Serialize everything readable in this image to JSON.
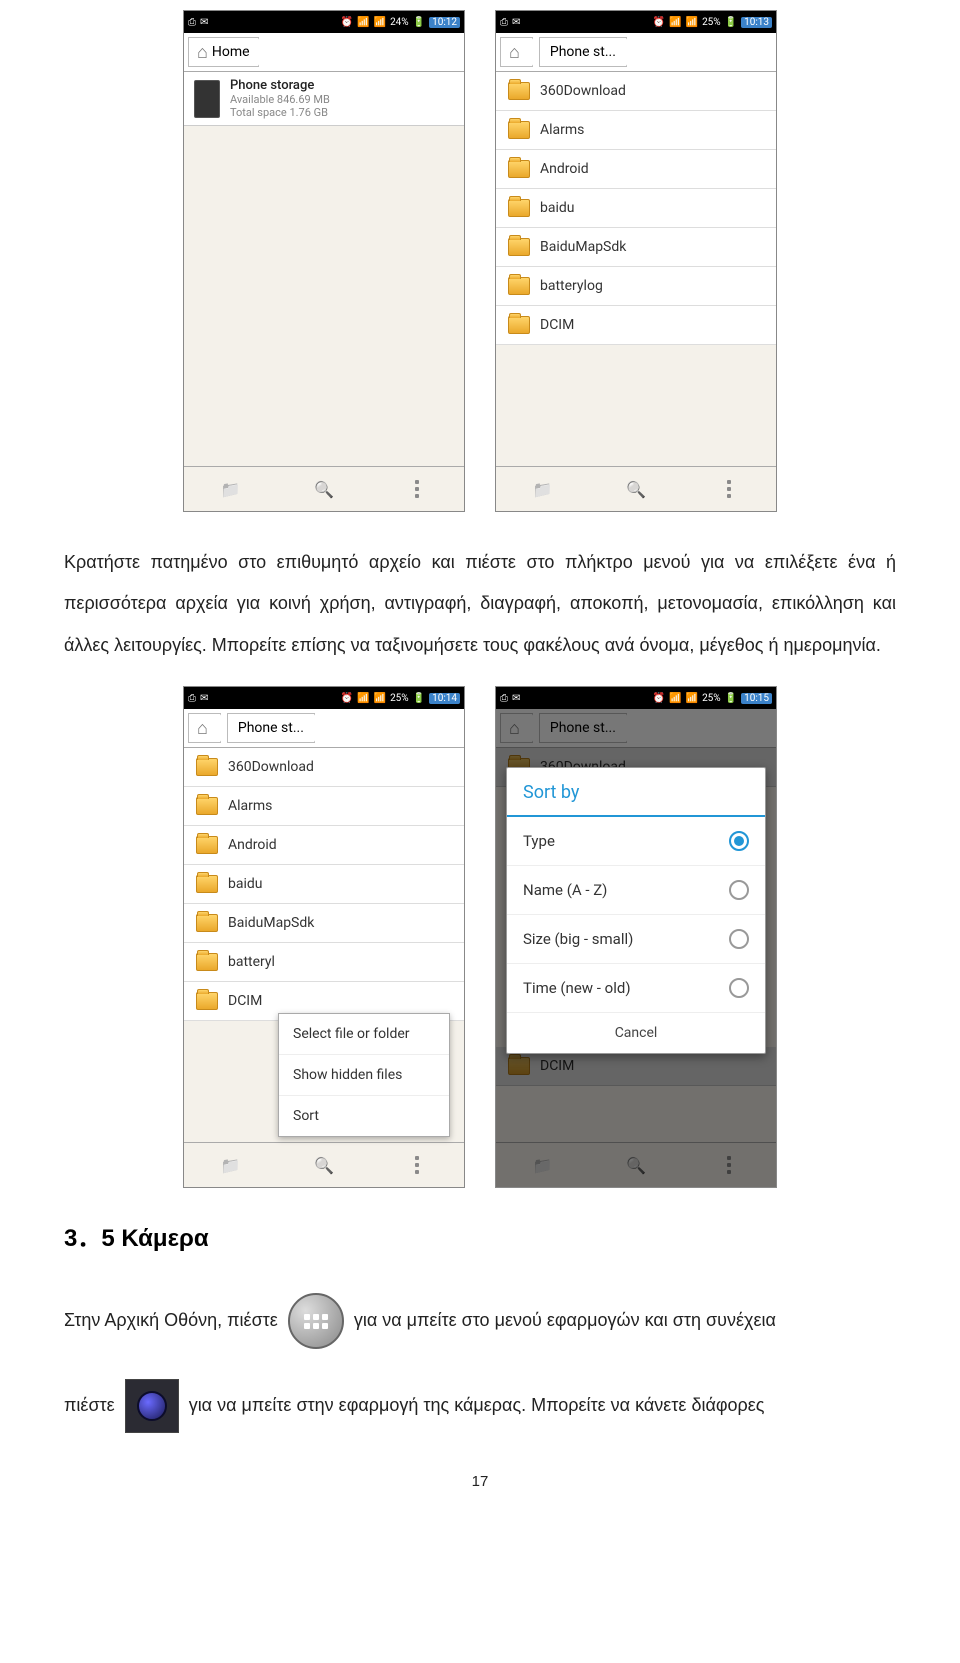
{
  "shot1": {
    "status": {
      "battery": "24%",
      "time": "10:12"
    },
    "breadcrumb": [
      "Home"
    ],
    "storage": {
      "title": "Phone storage",
      "avail": "Available 846.69 MB",
      "total": "Total space 1.76 GB"
    }
  },
  "shot2": {
    "status": {
      "battery": "25%",
      "time": "10:13"
    },
    "breadcrumb": [
      "",
      "Phone st..."
    ],
    "folders": [
      "360Download",
      "Alarms",
      "Android",
      "baidu",
      "BaiduMapSdk",
      "batterylog",
      "DCIM"
    ]
  },
  "para1": "Κρατήστε πατημένο στο επιθυμητό αρχείο και πιέστε στο πλήκτρο μενού για να επιλέξετε ένα ή περισσότερα αρχεία για κοινή χρήση, αντιγραφή, διαγραφή, αποκοπή, μετονομασία, επικόλληση και άλλες λειτουργίες. Μπορείτε επίσης να ταξινομήσετε τους φακέλους ανά όνομα, μέγεθος ή ημερομηνία.",
  "shot3": {
    "status": {
      "battery": "25%",
      "time": "10:14"
    },
    "breadcrumb": [
      "",
      "Phone st..."
    ],
    "folders": [
      "360Download",
      "Alarms",
      "Android",
      "baidu",
      "BaiduMapSdk",
      "batteryl",
      "DCIM"
    ],
    "menu": [
      "Select file or folder",
      "Show hidden files",
      "Sort"
    ]
  },
  "shot4": {
    "status": {
      "battery": "25%",
      "time": "10:15"
    },
    "breadcrumb": [
      "",
      "Phone st..."
    ],
    "folders_bg": [
      "360Download"
    ],
    "dcim": "DCIM",
    "dialog": {
      "title": "Sort by",
      "options": [
        {
          "label": "Type",
          "on": true
        },
        {
          "label": "Name (A - Z)",
          "on": false
        },
        {
          "label": "Size (big - small)",
          "on": false
        },
        {
          "label": "Time (new - old)",
          "on": false
        }
      ],
      "cancel": "Cancel"
    }
  },
  "section": "3．5  Κάμερα",
  "line1a": "Στην Αρχική Οθόνη, πιέστε",
  "line1b": "για να μπείτε στο μενού εφαρμογών και στη συνέχεια",
  "line2a": "πιέστε",
  "line2b": "για να μπείτε στην εφαρμογή της κάμερας. Μπορείτε να κάνετε διάφορες",
  "pagenum": "17"
}
